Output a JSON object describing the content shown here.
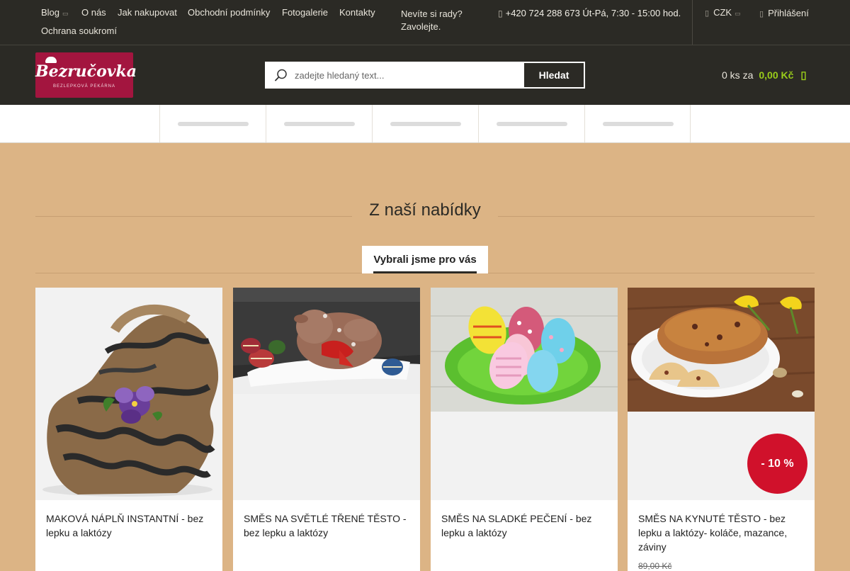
{
  "topbar": {
    "nav": [
      {
        "label": "Blog",
        "caret": "▭"
      },
      {
        "label": "O nás"
      },
      {
        "label": "Jak nakupovat"
      },
      {
        "label": "Obchodní podmínky"
      },
      {
        "label": "Fotogalerie"
      },
      {
        "label": "Kontakty"
      },
      {
        "label": "Ochrana soukromí"
      }
    ],
    "advice_line1": "Nevíte si rady?",
    "advice_line2": "Zavolejte.",
    "phone_icon": "phone-icon",
    "phone": "+420 724 288 673",
    "hours": "Út-Pá, 7:30 - 15:00 hod.",
    "currency": "CZK",
    "currency_caret": "▭",
    "login": "Přihlášení"
  },
  "header": {
    "logo_text": "Bezručovka",
    "logo_sub": "BEZLEPKOVÁ PEKÁRNA",
    "search_placeholder": "zadejte hledaný text...",
    "search_button": "Hledat",
    "cart_count": "0 ks za",
    "cart_price": "0,00 Kč"
  },
  "section": {
    "title": "Z naší nabídky",
    "tab": "Vybrali jsme pro vás"
  },
  "products": [
    {
      "title": "MAKOVÁ NÁPLŇ INSTANTNÍ - bez lepku a laktózy"
    },
    {
      "title": "SMĚS NA SVĚTLÉ TŘENÉ TĚSTO - bez lepku a laktózy"
    },
    {
      "title": "SMĚS NA SLADKÉ PEČENÍ - bez lepku a laktózy"
    },
    {
      "title": "SMĚS NA KYNUTÉ TĚSTO - bez lepku a laktózy- koláče, mazance, záviny",
      "badge": "- 10 %",
      "old_price": "89,00 Kč"
    }
  ],
  "colors": {
    "topbar_bg": "#2b2a25",
    "page_bg": "#dcb485",
    "accent_green": "#9acd1a",
    "badge_red": "#d0112b",
    "logo_bg": "#a3153f"
  }
}
